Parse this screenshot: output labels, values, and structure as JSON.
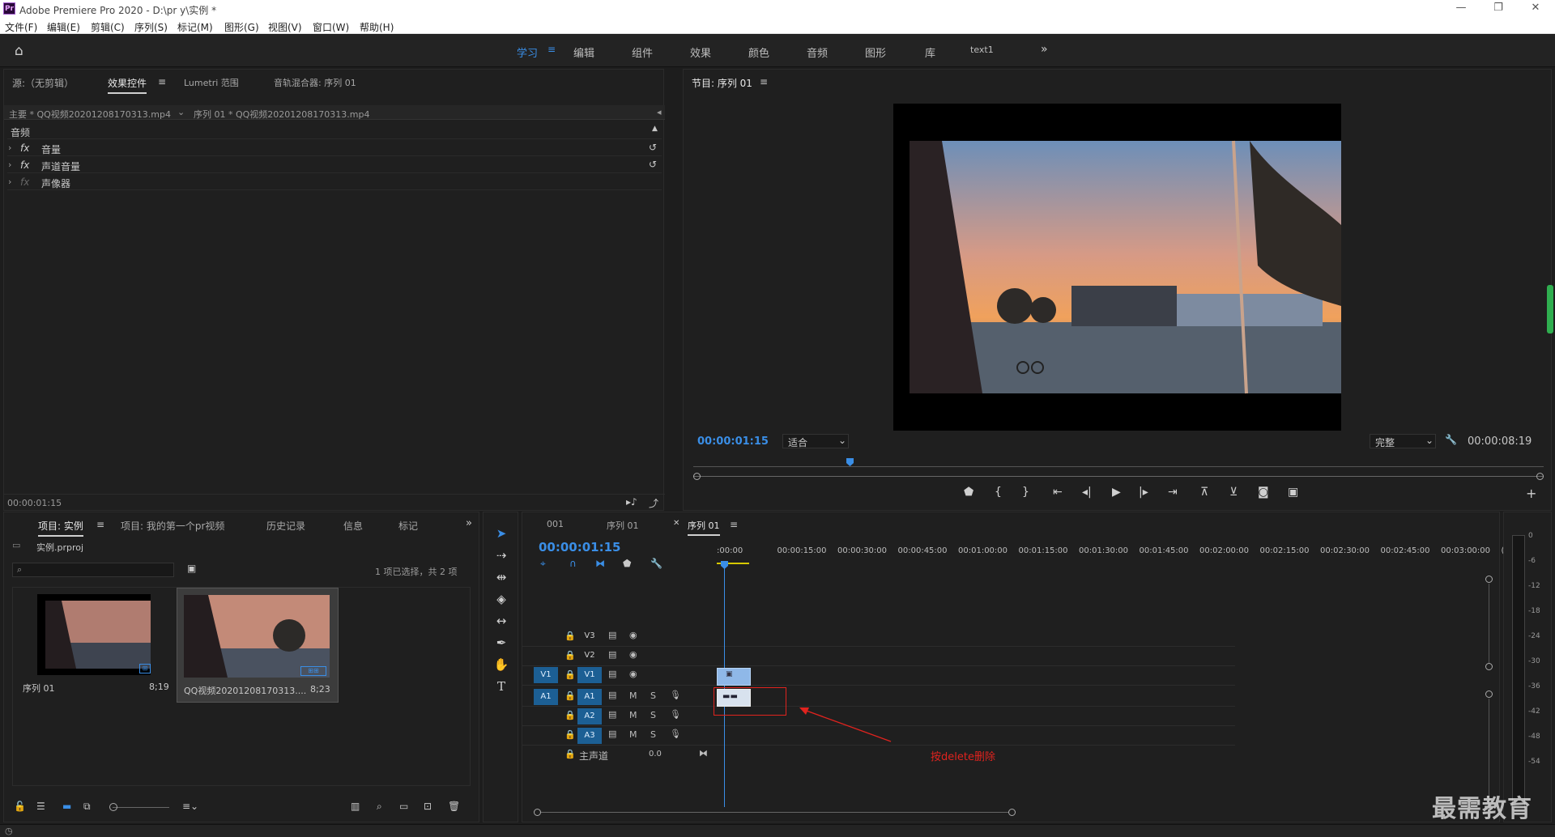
{
  "window": {
    "title": "Adobe Premiere Pro 2020 - D:\\pr y\\实例 *",
    "logo": "Pr",
    "min": "—",
    "max": "❐",
    "close": "✕"
  },
  "menu": [
    "文件(F)",
    "编辑(E)",
    "剪辑(C)",
    "序列(S)",
    "标记(M)",
    "图形(G)",
    "视图(V)",
    "窗口(W)",
    "帮助(H)"
  ],
  "workspaces": [
    "学习",
    "编辑",
    "组件",
    "效果",
    "颜色",
    "音频",
    "图形",
    "库",
    "text1"
  ],
  "workspace_active": "学习",
  "source_panel": {
    "tabs": [
      "源:（无剪辑）",
      "效果控件",
      "Lumetri 范围",
      "音轨混合器: 序列 01"
    ],
    "active_tab": "效果控件",
    "master_clip": "主要 * QQ视频20201208170313.mp4",
    "sequence_clip": "序列 01 * QQ视频20201208170313.mp4",
    "section": "音频",
    "effects": [
      {
        "fx": "fx",
        "name": "音量"
      },
      {
        "fx": "fx",
        "name": "声道音量"
      },
      {
        "fx": "fx",
        "name": "声像器"
      }
    ],
    "timecode": "00:00:01:15"
  },
  "program_panel": {
    "title": "节目: 序列 01",
    "timecode": "00:00:01:15",
    "fit": "适合",
    "quality": "完整",
    "duration": "00:00:08:19",
    "playhead_fraction": 0.18
  },
  "project_panel": {
    "tabs": [
      "项目: 实例",
      "项目: 我的第一个pr视频",
      "历史记录",
      "信息",
      "标记"
    ],
    "active_tab": "项目: 实例",
    "project_file": "实例.prproj",
    "selection_info": "1 项已选择，共 2 项",
    "items": [
      {
        "name": "序列 01",
        "duration": "8;19"
      },
      {
        "name": "QQ视频20201208170313....",
        "duration": "8;23"
      }
    ]
  },
  "timeline": {
    "tabs": [
      "001",
      "序列 01",
      "序列 01"
    ],
    "active_tab": "序列 01",
    "timecode": "00:00:01:15",
    "ruler": [
      ":00:00",
      "00:00:15:00",
      "00:00:30:00",
      "00:00:45:00",
      "00:01:00:00",
      "00:01:15:00",
      "00:01:30:00",
      "00:01:45:00",
      "00:02:00:00",
      "00:02:15:00",
      "00:02:30:00",
      "00:02:45:00",
      "00:03:00:00",
      "("
    ],
    "video_tracks": [
      "V3",
      "V2",
      "V1"
    ],
    "audio_tracks": [
      "A1",
      "A2",
      "A3"
    ],
    "source_patch_v": "V1",
    "source_patch_a": "A1",
    "mix_label": "主声道",
    "mix_value": "0.0",
    "m_label": "M",
    "s_label": "S",
    "annotation": "按delete删除"
  },
  "meter": {
    "scale": [
      "0",
      "-6",
      "-12",
      "-18",
      "-24",
      "-30",
      "-36",
      "-42",
      "-48",
      "-54"
    ]
  },
  "watermark": "最需教育",
  "colors": {
    "accent": "#3a8ee6",
    "clip_video": "#8fb8e8",
    "annotation": "#e0231e",
    "track_select": "#1c5f94"
  }
}
